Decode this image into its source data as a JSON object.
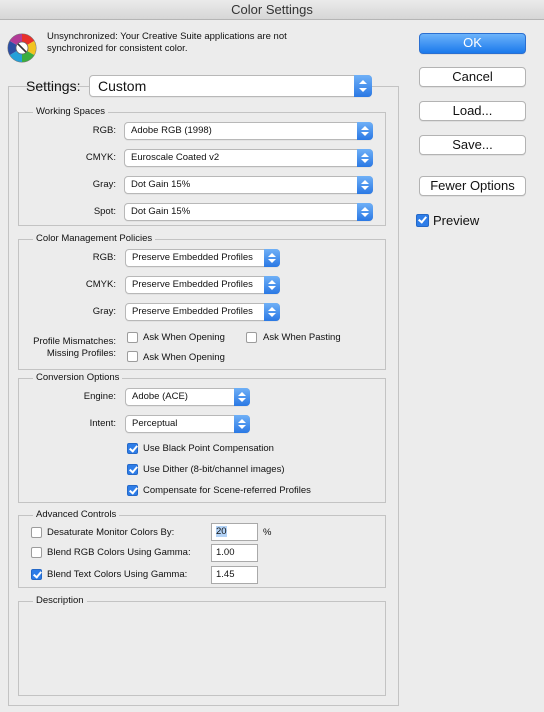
{
  "window": {
    "title": "Color Settings"
  },
  "warning": {
    "line1": "Unsynchronized: Your Creative Suite applications are not",
    "line2": "synchronized for consistent color."
  },
  "settings": {
    "label": "Settings:",
    "value": "Custom"
  },
  "working_spaces": {
    "title": "Working Spaces",
    "rgb": {
      "label": "RGB:",
      "value": "Adobe RGB (1998)"
    },
    "cmyk": {
      "label": "CMYK:",
      "value": "Euroscale Coated v2"
    },
    "gray": {
      "label": "Gray:",
      "value": "Dot Gain 15%"
    },
    "spot": {
      "label": "Spot:",
      "value": "Dot Gain 15%"
    }
  },
  "policies": {
    "title": "Color Management Policies",
    "rgb": {
      "label": "RGB:",
      "value": "Preserve Embedded Profiles"
    },
    "cmyk": {
      "label": "CMYK:",
      "value": "Preserve Embedded Profiles"
    },
    "gray": {
      "label": "Gray:",
      "value": "Preserve Embedded Profiles"
    },
    "mismatch_label": "Profile Mismatches:",
    "missing_label": "Missing Profiles:",
    "ask_opening": "Ask When Opening",
    "ask_pasting": "Ask When Pasting",
    "ask_opening_missing": "Ask When Opening",
    "ask_opening_checked": false,
    "ask_pasting_checked": false,
    "ask_opening_missing_checked": false
  },
  "conversion": {
    "title": "Conversion Options",
    "engine": {
      "label": "Engine:",
      "value": "Adobe (ACE)"
    },
    "intent": {
      "label": "Intent:",
      "value": "Perceptual"
    },
    "black_point": {
      "label": "Use Black Point Compensation",
      "checked": true
    },
    "dither": {
      "label": "Use Dither (8-bit/channel images)",
      "checked": true
    },
    "scene": {
      "label": "Compensate for Scene-referred Profiles",
      "checked": true
    }
  },
  "advanced": {
    "title": "Advanced Controls",
    "desaturate": {
      "label": "Desaturate Monitor Colors By:",
      "value": "20",
      "unit": "%",
      "checked": false
    },
    "blend_rgb": {
      "label": "Blend RGB Colors Using Gamma:",
      "value": "1.00",
      "checked": false
    },
    "blend_text": {
      "label": "Blend Text Colors Using Gamma:",
      "value": "1.45",
      "checked": true
    }
  },
  "description": {
    "title": "Description"
  },
  "buttons": {
    "ok": "OK",
    "cancel": "Cancel",
    "load": "Load...",
    "save": "Save...",
    "fewer": "Fewer Options"
  },
  "preview": {
    "label": "Preview",
    "checked": true
  },
  "colors": {
    "accent": "#2e7de8",
    "background": "#ececec"
  }
}
